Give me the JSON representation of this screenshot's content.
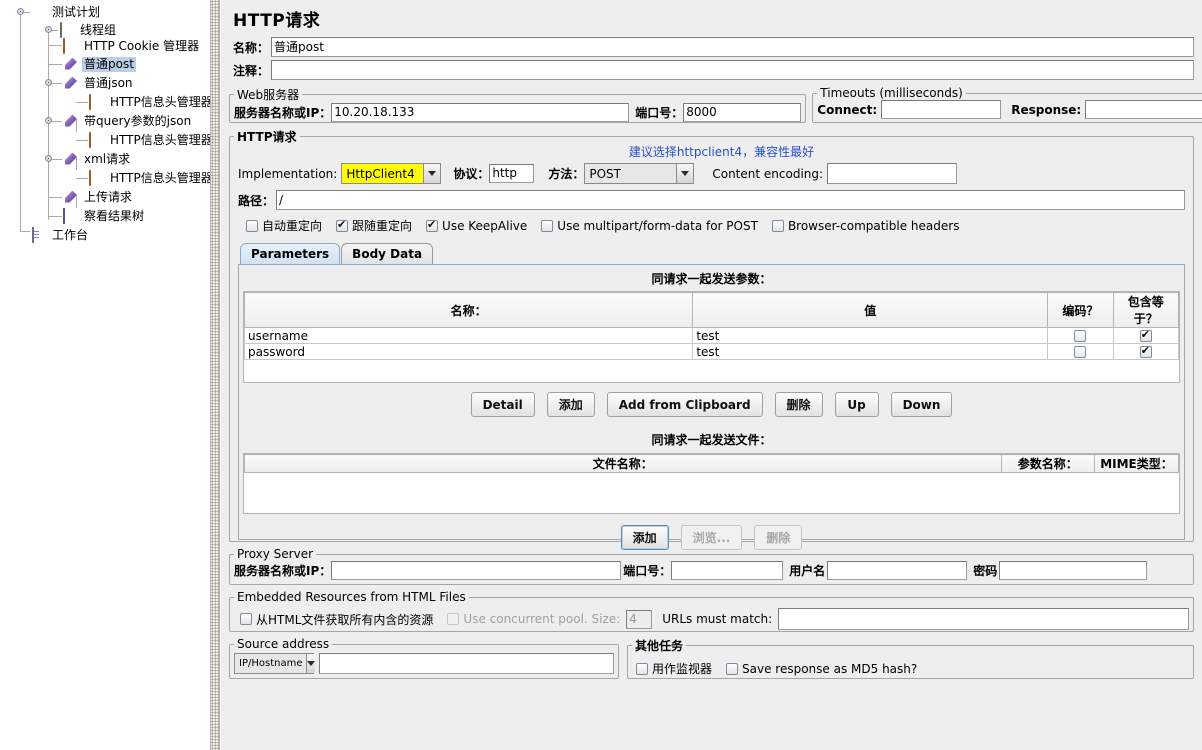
{
  "tree": {
    "nodes": [
      {
        "label": "测试计划",
        "icon": "flask-icon",
        "depth": 0,
        "selected": false
      },
      {
        "label": "线程组",
        "icon": "thread-group-icon",
        "depth": 1,
        "selected": false
      },
      {
        "label": "HTTP Cookie 管理器",
        "icon": "cookie-manager-icon",
        "depth": 2,
        "selected": false
      },
      {
        "label": "普通post",
        "icon": "http-sampler-icon",
        "depth": 2,
        "selected": true
      },
      {
        "label": "普通json",
        "icon": "http-sampler-icon",
        "depth": 2,
        "selected": false
      },
      {
        "label": "HTTP信息头管理器",
        "icon": "header-manager-icon",
        "depth": 3,
        "selected": false
      },
      {
        "label": "带query参数的json",
        "icon": "http-sampler-icon",
        "depth": 2,
        "selected": false
      },
      {
        "label": "HTTP信息头管理器",
        "icon": "header-manager-icon",
        "depth": 3,
        "selected": false
      },
      {
        "label": "xml请求",
        "icon": "http-sampler-icon",
        "depth": 2,
        "selected": false
      },
      {
        "label": "HTTP信息头管理器",
        "icon": "header-manager-icon",
        "depth": 3,
        "selected": false
      },
      {
        "label": "上传请求",
        "icon": "http-sampler-icon",
        "depth": 2,
        "selected": false
      },
      {
        "label": "察看结果树",
        "icon": "view-results-tree-icon",
        "depth": 2,
        "selected": false
      },
      {
        "label": "工作台",
        "icon": "workbench-icon",
        "depth": 0,
        "selected": false
      }
    ]
  },
  "page": {
    "title": "HTTP请求",
    "name_label": "名称：",
    "name_value": "普通post",
    "comment_label": "注释：",
    "comment_value": ""
  },
  "web_server": {
    "legend": "Web服务器",
    "host_label": "服务器名称或IP：",
    "host_value": "10.20.18.133",
    "port_label": "端口号：",
    "port_value": "8000"
  },
  "timeouts": {
    "legend": "Timeouts (milliseconds)",
    "connect_label": "Connect:",
    "connect_value": "",
    "response_label": "Response:",
    "response_value": ""
  },
  "http_request": {
    "legend": "HTTP请求",
    "annotation": "建议选择httpclient4，兼容性最好",
    "annotation_color": "#2b4fcc",
    "implementation_label": "Implementation:",
    "implementation_value": "HttpClient4",
    "implementation_highlight": "#ffff00",
    "protocol_label": "协议：",
    "protocol_value": "http",
    "method_label": "方法：",
    "method_value": "POST",
    "content_encoding_label": "Content encoding:",
    "content_encoding_value": "",
    "path_label": "路径：",
    "path_value": "/",
    "options": [
      {
        "label": "自动重定向",
        "checked": false
      },
      {
        "label": "跟随重定向",
        "checked": true
      },
      {
        "label": "Use KeepAlive",
        "checked": true
      },
      {
        "label": "Use multipart/form-data for POST",
        "checked": false
      },
      {
        "label": "Browser-compatible headers",
        "checked": false
      }
    ],
    "tabs": [
      {
        "label": "Parameters",
        "active": true
      },
      {
        "label": "Body Data",
        "active": false
      }
    ],
    "params_caption": "同请求一起发送参数：",
    "params_columns": [
      "名称：",
      "值",
      "编码？",
      "包含等于？"
    ],
    "params_rows": [
      {
        "name": "username",
        "value": "test",
        "encode": false,
        "include_equals": true
      },
      {
        "name": "password",
        "value": "test",
        "encode": false,
        "include_equals": true
      }
    ],
    "params_buttons": [
      {
        "label": "Detail",
        "enabled": true,
        "focused": false
      },
      {
        "label": "添加",
        "enabled": true,
        "focused": false
      },
      {
        "label": "Add from Clipboard",
        "enabled": true,
        "focused": false
      },
      {
        "label": "删除",
        "enabled": true,
        "focused": false
      },
      {
        "label": "Up",
        "enabled": true,
        "focused": false
      },
      {
        "label": "Down",
        "enabled": true,
        "focused": false
      }
    ],
    "files_caption": "同请求一起发送文件：",
    "files_columns": [
      "文件名称：",
      "参数名称：",
      "MIME类型："
    ],
    "files_rows": [],
    "files_buttons": [
      {
        "label": "添加",
        "enabled": true,
        "focused": true
      },
      {
        "label": "浏览...",
        "enabled": false,
        "focused": false
      },
      {
        "label": "删除",
        "enabled": false,
        "focused": false
      }
    ]
  },
  "proxy": {
    "legend": "Proxy Server",
    "host_label": "服务器名称或IP：",
    "host_value": "",
    "port_label": "端口号：",
    "port_value": "",
    "user_label": "用户名",
    "user_value": "",
    "password_label": "密码",
    "password_value": ""
  },
  "embedded": {
    "legend": "Embedded Resources from HTML Files",
    "retrieve_label": "从HTML文件获取所有内含的资源",
    "retrieve_checked": false,
    "pool_label": "Use concurrent pool. Size:",
    "pool_checked": false,
    "pool_enabled": false,
    "pool_size": "4",
    "urls_label": "URLs must match:",
    "urls_value": ""
  },
  "source_address": {
    "legend": "Source address",
    "type_value": "IP/Hostname",
    "value": ""
  },
  "other_tasks": {
    "legend": "其他任务",
    "items": [
      {
        "label": "用作监视器",
        "checked": false
      },
      {
        "label": "Save response as MD5 hash?",
        "checked": false
      }
    ]
  }
}
